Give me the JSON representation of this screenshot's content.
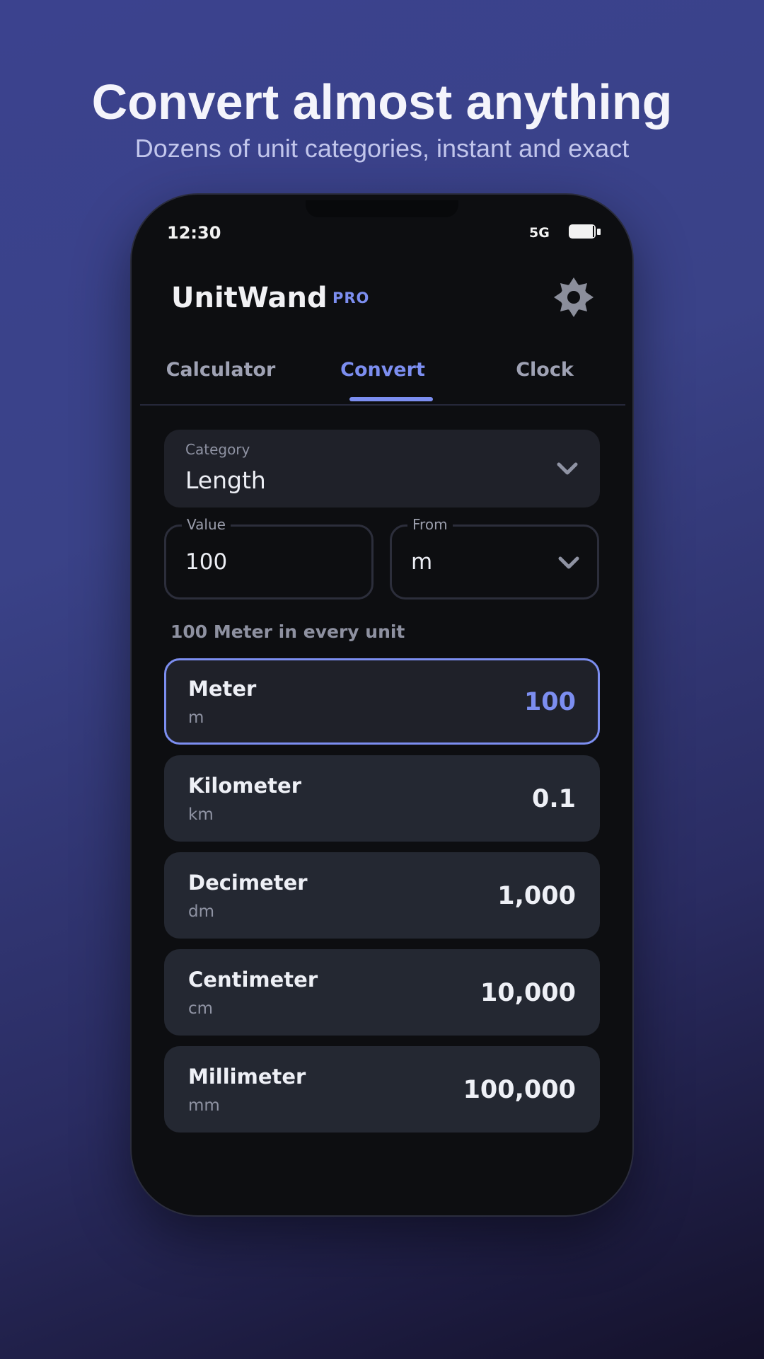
{
  "promo": {
    "headline": "Convert almost anything",
    "subhead": "Dozens of unit categories, instant and exact"
  },
  "status_bar": {
    "time": "12:30",
    "network": "5G",
    "battery_icon": "battery-full-icon"
  },
  "app": {
    "title": "UnitWand",
    "badge": "PRO",
    "settings_icon": "gear-icon",
    "accent_color": "#7c8ef0"
  },
  "tabs": [
    {
      "label": "Calculator",
      "active": false
    },
    {
      "label": "Convert",
      "active": true
    },
    {
      "label": "Clock",
      "active": false
    }
  ],
  "converter": {
    "category_label": "Category",
    "category_value": "Length",
    "value_label": "Value",
    "value": "100",
    "from_label": "From",
    "from_value": "m",
    "results_label": "100 Meter in every unit"
  },
  "units": [
    {
      "name": "Meter",
      "symbol": "m",
      "value": "100",
      "selected": true
    },
    {
      "name": "Kilometer",
      "symbol": "km",
      "value": "0.1",
      "selected": false
    },
    {
      "name": "Decimeter",
      "symbol": "dm",
      "value": "1,000",
      "selected": false
    },
    {
      "name": "Centimeter",
      "symbol": "cm",
      "value": "10,000",
      "selected": false
    },
    {
      "name": "Millimeter",
      "symbol": "mm",
      "value": "100,000",
      "selected": false
    }
  ]
}
